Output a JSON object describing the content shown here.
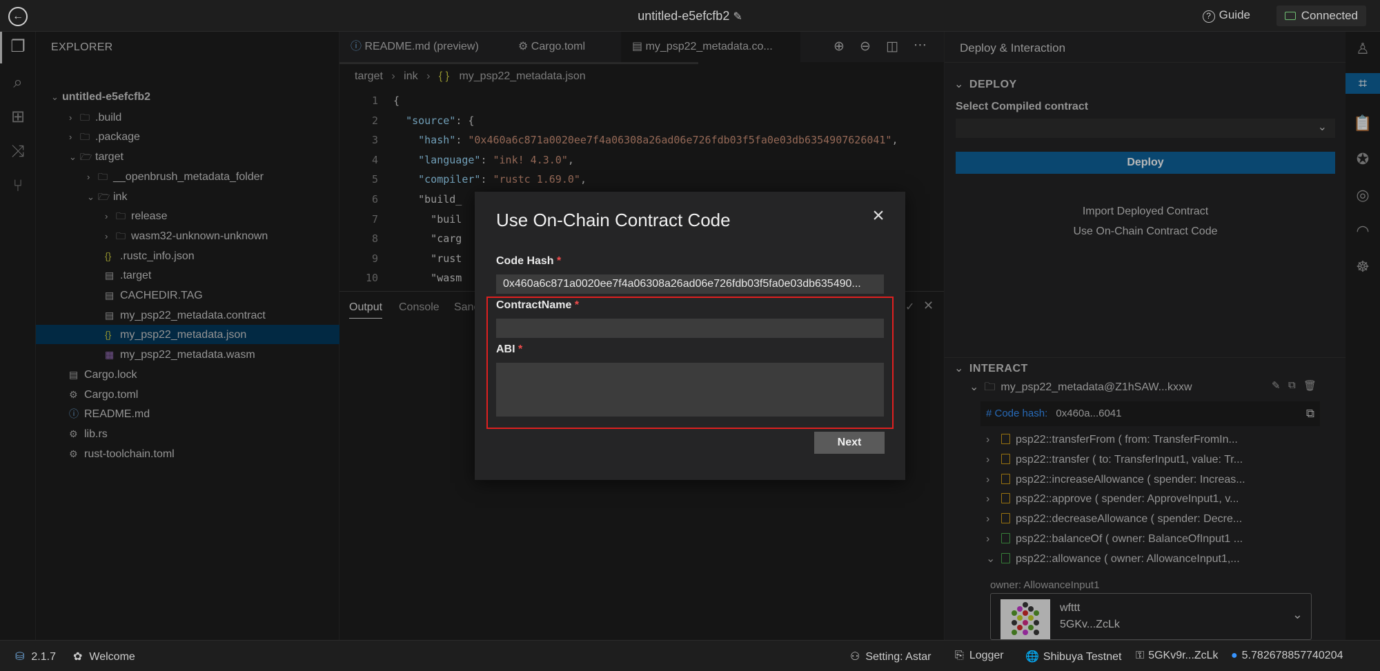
{
  "app": {
    "title": "untitled-e5efcfb2",
    "guide_label": "Guide",
    "connection_status": "Connected"
  },
  "explorer": {
    "title": "EXPLORER",
    "tree": [
      {
        "label": "untitled-e5efcfb2",
        "depth": 0,
        "type": "folder-open",
        "bold": true
      },
      {
        "label": ".build",
        "depth": 1,
        "type": "folder"
      },
      {
        "label": ".package",
        "depth": 1,
        "type": "folder"
      },
      {
        "label": "target",
        "depth": 1,
        "type": "folder-open"
      },
      {
        "label": "__openbrush_metadata_folder",
        "depth": 2,
        "type": "folder"
      },
      {
        "label": "ink",
        "depth": 2,
        "type": "folder-open"
      },
      {
        "label": "release",
        "depth": 3,
        "type": "folder"
      },
      {
        "label": "wasm32-unknown-unknown",
        "depth": 3,
        "type": "folder"
      },
      {
        "label": ".rustc_info.json",
        "depth": 3,
        "type": "json"
      },
      {
        "label": ".target",
        "depth": 3,
        "type": "file"
      },
      {
        "label": "CACHEDIR.TAG",
        "depth": 3,
        "type": "file"
      },
      {
        "label": "my_psp22_metadata.contract",
        "depth": 3,
        "type": "file"
      },
      {
        "label": "my_psp22_metadata.json",
        "depth": 3,
        "type": "json",
        "selected": true
      },
      {
        "label": "my_psp22_metadata.wasm",
        "depth": 3,
        "type": "wasm"
      },
      {
        "label": "Cargo.lock",
        "depth": 1,
        "type": "file"
      },
      {
        "label": "Cargo.toml",
        "depth": 1,
        "type": "gear"
      },
      {
        "label": "README.md",
        "depth": 1,
        "type": "info"
      },
      {
        "label": "lib.rs",
        "depth": 1,
        "type": "rust"
      },
      {
        "label": "rust-toolchain.toml",
        "depth": 1,
        "type": "gear"
      }
    ]
  },
  "editor": {
    "tabs": [
      {
        "label": "README.md (preview)",
        "icon": "info-icon"
      },
      {
        "label": "Cargo.toml",
        "icon": "gear-icon"
      },
      {
        "label": "my_psp22_metadata.co...",
        "icon": "file-icon",
        "active": true
      }
    ],
    "breadcrumb": [
      "target",
      "ink",
      "{ }",
      "my_psp22_metadata.json"
    ],
    "lines": [
      {
        "n": "1",
        "text": "{"
      },
      {
        "n": "2",
        "text": "  \"source\": {"
      },
      {
        "n": "3",
        "text": "    \"hash\": \"0x460a6c871a0020ee7f4a06308a26ad06e726fdb03f5fa0e03db6354907626041\","
      },
      {
        "n": "4",
        "text": "    \"language\": \"ink! 4.3.0\","
      },
      {
        "n": "5",
        "text": "    \"compiler\": \"rustc 1.69.0\","
      },
      {
        "n": "6",
        "text": "    \"build_"
      },
      {
        "n": "7",
        "text": "      \"buil"
      },
      {
        "n": "8",
        "text": "      \"carg"
      },
      {
        "n": "9",
        "text": "      \"rust"
      },
      {
        "n": "10",
        "text": "      \"wasm"
      }
    ],
    "panel_tabs": [
      "Output",
      "Console",
      "Sanc"
    ]
  },
  "deploy": {
    "title": "Deploy & Interaction",
    "section_deploy": "DEPLOY",
    "select_label": "Select Compiled contract",
    "deploy_button": "Deploy",
    "import_link": "Import Deployed Contract",
    "onchain_link": "Use On-Chain Contract Code",
    "section_interact": "INTERACT",
    "contract_instance": "my_psp22_metadata@Z1hSAW...kxxw",
    "code_hash_label": "# Code hash:",
    "code_hash_value": "0x460a...6041",
    "methods": [
      {
        "label": "psp22::transferFrom ( from: TransferFromIn...",
        "kind": "tx"
      },
      {
        "label": "psp22::transfer ( to: TransferInput1, value: Tr...",
        "kind": "tx"
      },
      {
        "label": "psp22::increaseAllowance ( spender: Increas...",
        "kind": "tx"
      },
      {
        "label": "psp22::approve ( spender: ApproveInput1, v...",
        "kind": "tx"
      },
      {
        "label": "psp22::decreaseAllowance ( spender: Decre...",
        "kind": "tx"
      },
      {
        "label": "psp22::balanceOf ( owner: BalanceOfInput1 ...",
        "kind": "query"
      },
      {
        "label": "psp22::allowance ( owner: AllowanceInput1,...",
        "kind": "query",
        "expanded": true
      }
    ],
    "owner_label": "owner: AllowanceInput1",
    "account_name": "wfttt",
    "account_address": "5GKv...ZcLk"
  },
  "modal": {
    "title": "Use On-Chain Contract Code",
    "code_hash_label": "Code Hash",
    "code_hash_value": "0x460a6c871a0020ee7f4a06308a26ad06e726fdb03f5fa0e03db635490...",
    "contract_name_label": "ContractName",
    "contract_name_value": "",
    "abi_label": "ABI",
    "abi_value": "",
    "required_mark": "*",
    "next_button": "Next"
  },
  "statusbar": {
    "version": "2.1.7",
    "welcome": "Welcome",
    "setting": "Setting: Astar",
    "logger": "Logger",
    "network": "Shibuya Testnet",
    "account": "5GKv9r...ZcLk",
    "balance": "5.782678857740204"
  },
  "colors": {
    "accent": "#0e639c",
    "selection": "#04395e",
    "required": "#f14c4c",
    "highlight": "#e02020"
  }
}
